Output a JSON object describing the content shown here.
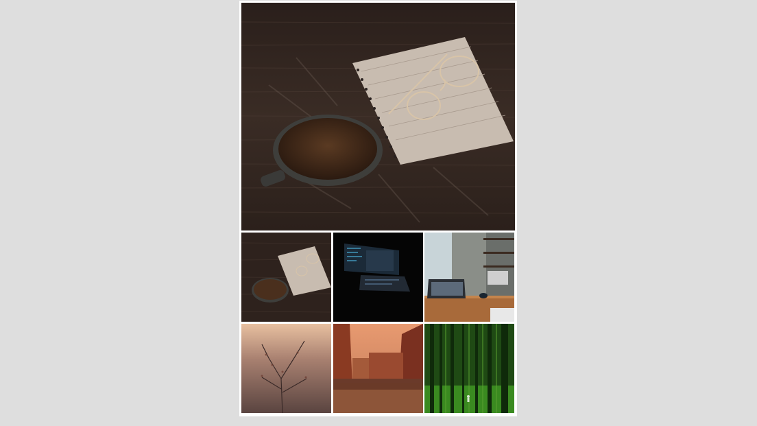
{
  "gallery": {
    "main_image": {
      "icon": "coffee-notebook-glasses-photo"
    },
    "thumbnails": [
      {
        "icon": "coffee-notebook-glasses-photo",
        "selected": true
      },
      {
        "icon": "dual-monitor-code-photo",
        "selected": false
      },
      {
        "icon": "laptop-kitchen-counter-photo",
        "selected": false
      },
      {
        "icon": "misty-branches-photo",
        "selected": false
      },
      {
        "icon": "brick-canal-buildings-photo",
        "selected": false
      },
      {
        "icon": "green-forest-photo",
        "selected": false
      }
    ]
  },
  "colors": {
    "page_background": "#dedede",
    "frame": "#ffffff"
  }
}
